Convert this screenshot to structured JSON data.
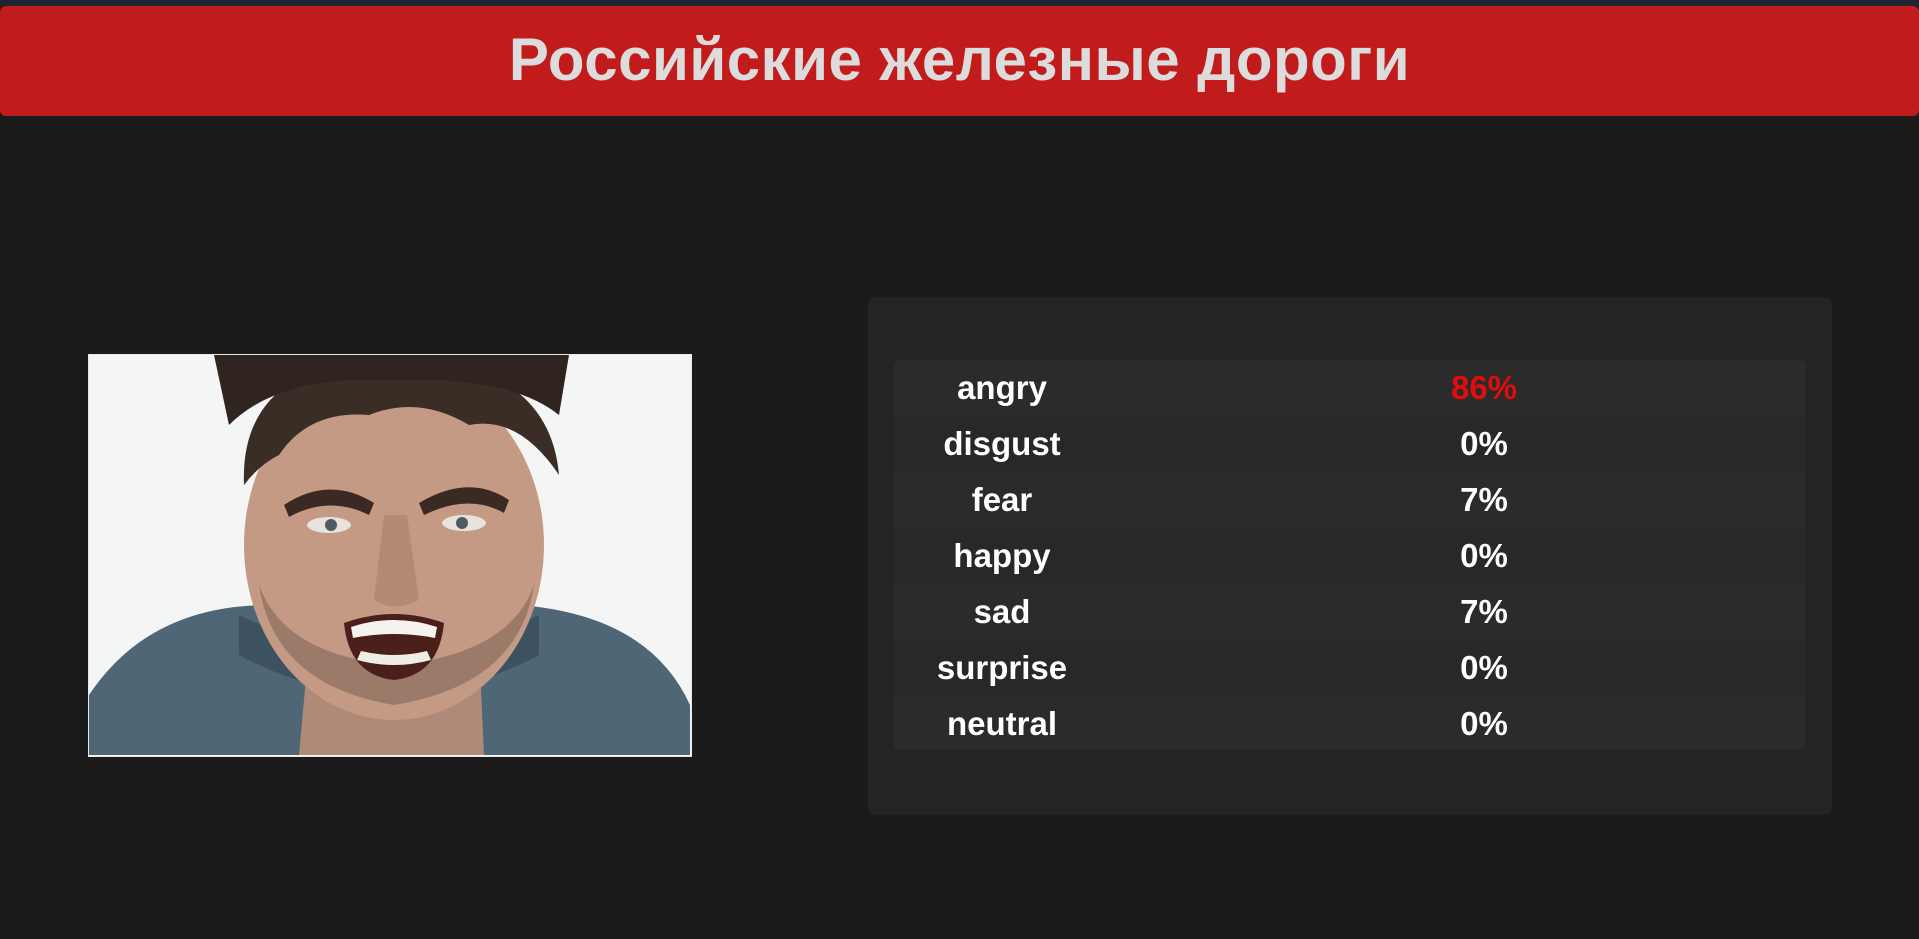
{
  "header": {
    "title": "Российские железные дороги",
    "background_color": "#c21b1b",
    "title_color": "#dcdcdc"
  },
  "photo": {
    "description_icon": "face-photo"
  },
  "results": {
    "highlight_color": "#e00d0d",
    "rows": [
      {
        "label": "angry",
        "value": "86%",
        "highlighted": true
      },
      {
        "label": "disgust",
        "value": "0%",
        "highlighted": false
      },
      {
        "label": "fear",
        "value": "7%",
        "highlighted": false
      },
      {
        "label": "happy",
        "value": "0%",
        "highlighted": false
      },
      {
        "label": "sad",
        "value": "7%",
        "highlighted": false
      },
      {
        "label": "surprise",
        "value": "0%",
        "highlighted": false
      },
      {
        "label": "neutral",
        "value": "0%",
        "highlighted": false
      }
    ]
  }
}
